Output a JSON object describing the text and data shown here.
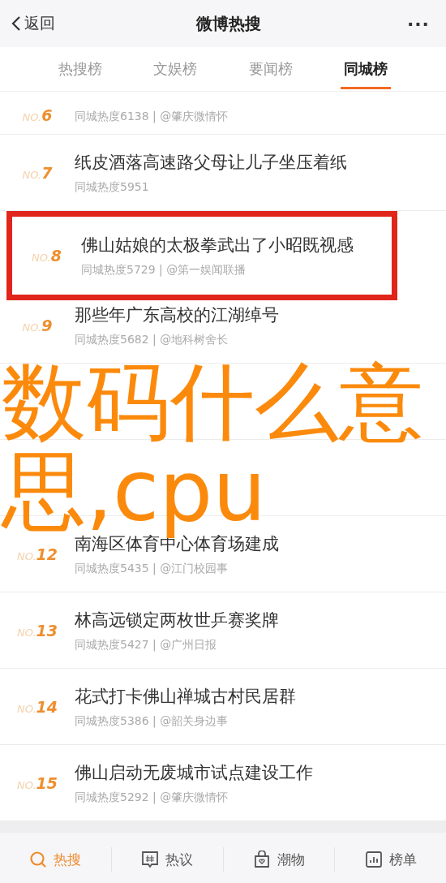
{
  "header": {
    "back": "返回",
    "title": "微博热搜",
    "more": "···"
  },
  "tabs": [
    {
      "label": "热搜榜",
      "selected": false
    },
    {
      "label": "文娱榜",
      "selected": false
    },
    {
      "label": "要闻榜",
      "selected": false
    },
    {
      "label": "同城榜",
      "selected": true
    }
  ],
  "items": [
    {
      "rank_prefix": "NO.",
      "rank": "6",
      "meta": "同城热度6138 | @肇庆微情怀",
      "highlighted": false
    },
    {
      "rank_prefix": "NO.",
      "rank": "7",
      "title": "纸皮酒落高速路父母让儿子坐压着纸",
      "meta": "同城热度5951",
      "highlighted": false
    },
    {
      "rank_prefix": "NO.",
      "rank": "8",
      "title": "佛山姑娘的太极拳武出了小昭既视感",
      "meta": "同城热度5729 | @第一娱闻联播",
      "highlighted": true
    },
    {
      "rank_prefix": "NO.",
      "rank": "9",
      "title": "那些年广东高校的江湖绰号",
      "meta": "同城热度5682 | @地科树舍长",
      "highlighted": false
    },
    {
      "kind": "covered"
    },
    {
      "kind": "covered"
    },
    {
      "rank_prefix": "NO.",
      "rank": "12",
      "title": "南海区体育中心体育场建成",
      "meta": "同城热度5435 | @江门校园事",
      "highlighted": false
    },
    {
      "rank_prefix": "NO.",
      "rank": "13",
      "title": "林高远锁定两枚世乒赛奖牌",
      "meta": "同城热度5427 | @广州日报",
      "highlighted": false
    },
    {
      "rank_prefix": "NO.",
      "rank": "14",
      "title": "花式打卡佛山禅城古村民居群",
      "meta": "同城热度5386 | @韶关身边事",
      "highlighted": false
    },
    {
      "rank_prefix": "NO.",
      "rank": "15",
      "title": "佛山启动无废城市试点建设工作",
      "meta": "同城热度5292 | @肇庆微情怀",
      "highlighted": false
    }
  ],
  "bottom_nav": [
    {
      "kind": "search",
      "label": "热搜",
      "selected": true
    },
    {
      "kind": "discuss",
      "label": "热议",
      "selected": false
    },
    {
      "kind": "bag",
      "label": "潮物",
      "selected": false
    },
    {
      "kind": "chart",
      "label": "榜单",
      "selected": false
    }
  ],
  "overlay_caption": "数码什么意思,cpu"
}
